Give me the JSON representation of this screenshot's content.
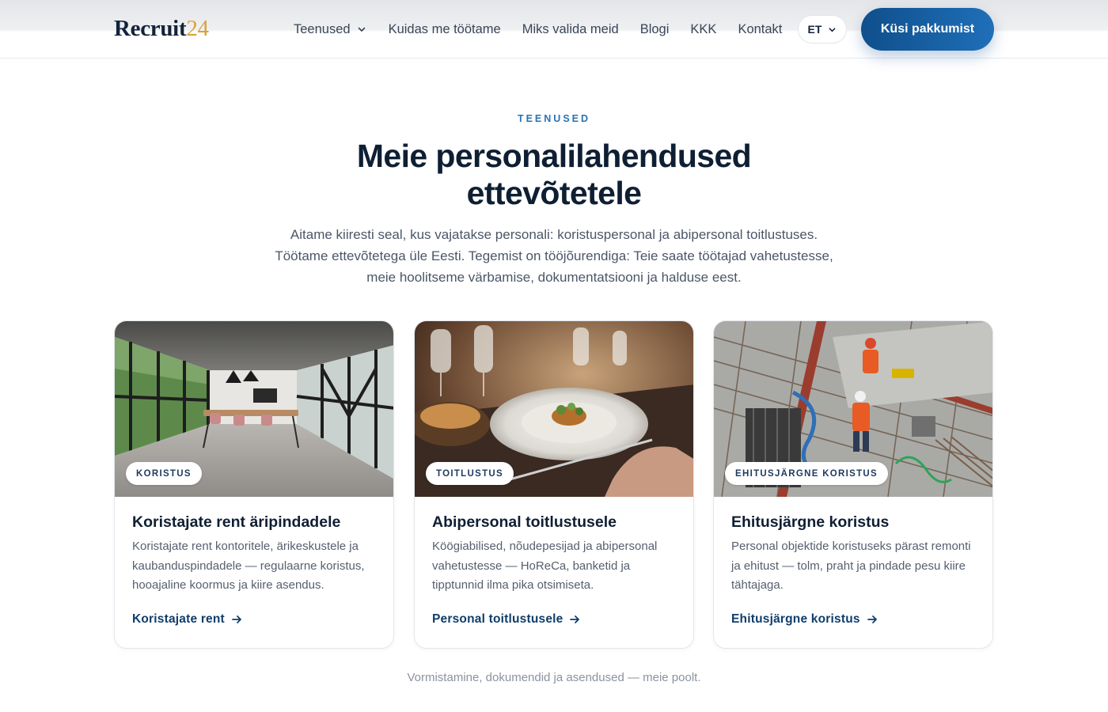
{
  "header": {
    "logo": {
      "word": "Recruit",
      "number": "24"
    },
    "nav": [
      {
        "label": "Teenused",
        "has_dropdown": true
      },
      {
        "label": "Kuidas me töötame"
      },
      {
        "label": "Miks valida meid"
      },
      {
        "label": "Blogi"
      },
      {
        "label": "KKK"
      },
      {
        "label": "Kontakt"
      }
    ],
    "language": {
      "value": "ET",
      "icon": "chevron-down-icon"
    },
    "cta_label": "Küsi pakkumist"
  },
  "intro": {
    "eyebrow": "TEENUSED",
    "title": "Meie personalilahendused ettevõtetele",
    "lead": "Aitame kiiresti seal, kus vajatakse personali: koristuspersonal ja abipersonal toitlustuses. Töötame ettevõtetega üle Eesti. Tegemist on tööjõurendiga: Teie saate töötajad vahetustesse, meie hoolitseme värbamise, dokumentatsiooni ja halduse eest."
  },
  "cards": [
    {
      "badge": "KORISTUS",
      "title": "Koristajate rent äripindadele",
      "description": "Koristajate rent kontoritele, ärikeskustele ja kaubanduspindadele — regulaarne koristus, hooajaline koormus ja kiire asendus.",
      "link": "Koristajate rent",
      "image": "office-interior-photo"
    },
    {
      "badge": "TOITLUSTUS",
      "title": "Abipersonal toitlustusele",
      "description": "Köögiabilised, nõudepesijad ja abipersonal vahetustesse — HoReCa, banketid ja tipptunnid ilma pika otsimiseta.",
      "link": "Personal toitlustusele",
      "image": "restaurant-plate-photo"
    },
    {
      "badge": "EHITUSJÄRGNE KORISTUS",
      "title": "Ehitusjärgne koristus",
      "description": "Personal objektide koristuseks pärast remonti ja ehitust — tolm, praht ja pindade pesu kiire tähtajaga.",
      "link": "Ehitusjärgne koristus",
      "image": "construction-site-photo"
    }
  ],
  "footnote": "Vormistamine, dokumendid ja asendused — meie poolt.",
  "colors": {
    "brand_dark": "#13233b",
    "brand_gold": "#d9a33a",
    "accent_blue": "#1f6fb8",
    "link_blue": "#0f3d6b"
  }
}
